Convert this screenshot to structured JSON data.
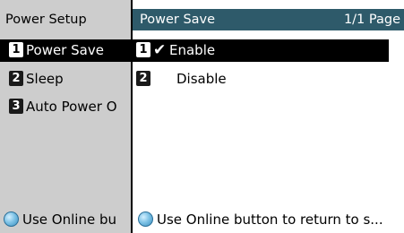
{
  "left_panel": {
    "title": "Power Setup",
    "items": [
      {
        "number": "1",
        "label": "Power Save",
        "selected": true
      },
      {
        "number": "2",
        "label": "Sleep",
        "selected": false
      },
      {
        "number": "3",
        "label": "Auto Power O",
        "selected": false
      }
    ],
    "footer": "Use Online bu"
  },
  "right_panel": {
    "title": "Power Save",
    "page": "1/1 Page",
    "options": [
      {
        "number": "1",
        "label": "Enable",
        "checked": true
      },
      {
        "number": "2",
        "label": "Disable",
        "checked": false
      }
    ],
    "footer": "Use Online button to return to s..."
  },
  "colors": {
    "header_bg": "#2e5a6a",
    "selected_bg": "#000000",
    "panel_bg": "#d4d4d4"
  },
  "icons": {
    "check": "checkmark-icon",
    "online_button": "online-button-icon"
  }
}
